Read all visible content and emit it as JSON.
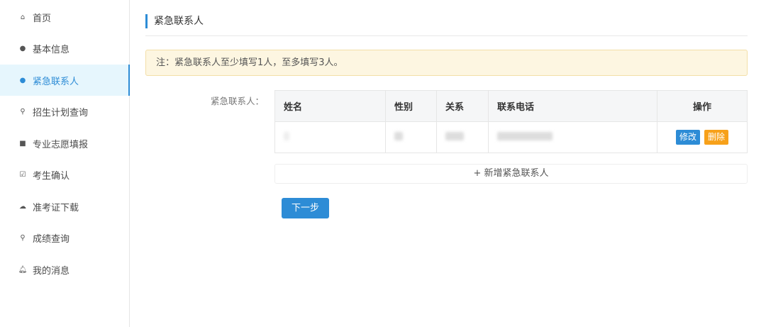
{
  "sidebar": {
    "items": [
      {
        "label": "首页",
        "icon": "home-icon"
      },
      {
        "label": "基本信息",
        "icon": "user-icon"
      },
      {
        "label": "紧急联系人",
        "icon": "user-icon",
        "active": true
      },
      {
        "label": "招生计划查询",
        "icon": "search-icon"
      },
      {
        "label": "专业志愿填报",
        "icon": "form-icon"
      },
      {
        "label": "考生确认",
        "icon": "checkbox-icon"
      },
      {
        "label": "准考证下载",
        "icon": "cloud-download-icon"
      },
      {
        "label": "成绩查询",
        "icon": "search-icon"
      },
      {
        "label": "我的消息",
        "icon": "bell-icon"
      }
    ]
  },
  "main": {
    "title": "紧急联系人",
    "notice": "注：紧急联系人至少填写1人，至多填写3人。",
    "field_label": "紧急联系人：",
    "table": {
      "headers": [
        "姓名",
        "性别",
        "关系",
        "联系电话",
        "操作"
      ],
      "actions": {
        "edit": "修改",
        "delete": "删除"
      }
    },
    "add_label": "+ 新增紧急联系人",
    "next_label": "下一步"
  },
  "colors": {
    "accent": "#2d8cd6",
    "warning": "#f7a11a",
    "notice_bg": "#fdf6e1"
  }
}
